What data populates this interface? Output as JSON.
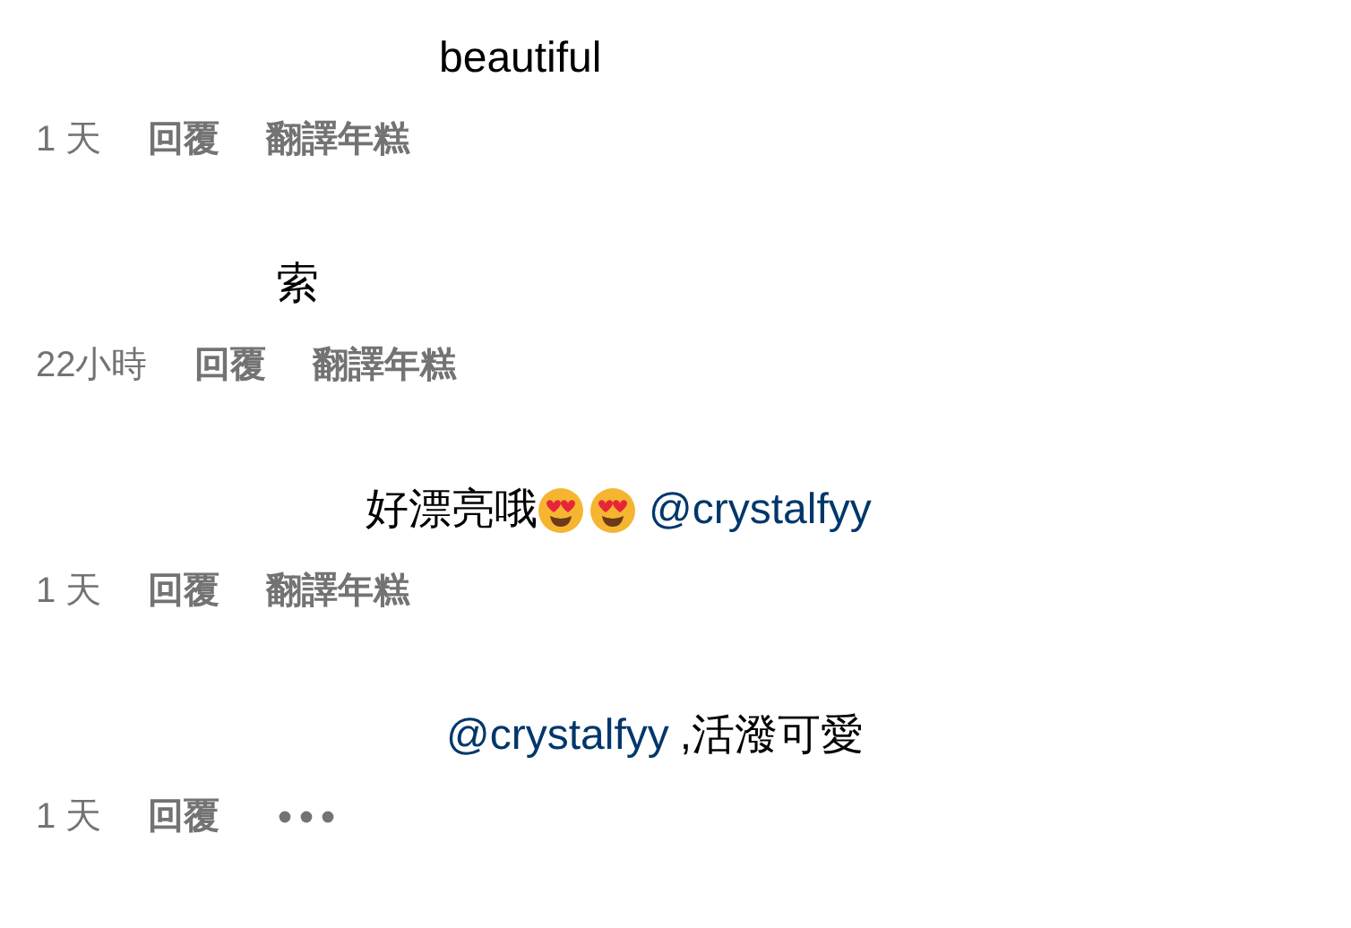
{
  "comments": [
    {
      "segments": [
        {
          "kind": "text",
          "text": "beautiful"
        }
      ],
      "time": "1 天",
      "actions": [
        "回覆",
        "翻譯年糕"
      ],
      "more": false
    },
    {
      "segments": [
        {
          "kind": "text",
          "text": "索"
        }
      ],
      "time": "22小時",
      "actions": [
        "回覆",
        "翻譯年糕"
      ],
      "more": false
    },
    {
      "segments": [
        {
          "kind": "text",
          "text": "好漂亮哦"
        },
        {
          "kind": "emoji"
        },
        {
          "kind": "emoji"
        },
        {
          "kind": "mention",
          "text": "@crystalfyy"
        }
      ],
      "time": "1 天",
      "actions": [
        "回覆",
        "翻譯年糕"
      ],
      "more": false
    },
    {
      "segments": [
        {
          "kind": "mention",
          "text": "@crystalfyy"
        },
        {
          "kind": "text",
          "text": ",活潑可愛"
        }
      ],
      "time": "1 天",
      "actions": [
        "回覆"
      ],
      "more": true
    }
  ]
}
